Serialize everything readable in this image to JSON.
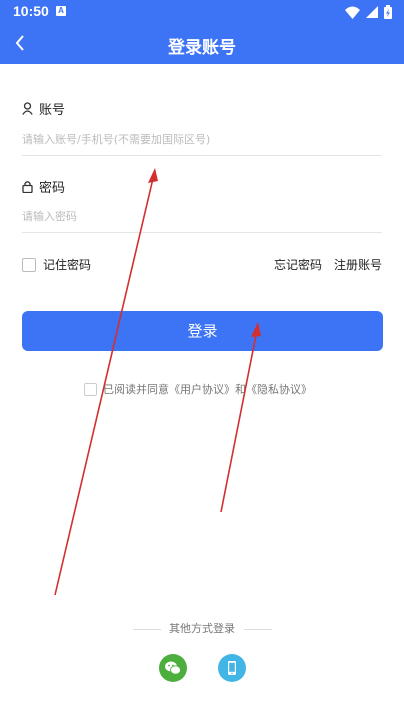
{
  "status_bar": {
    "time": "10:50",
    "notification_icon": "a-icon"
  },
  "header": {
    "title": "登录账号",
    "back_icon": "back-arrow-icon"
  },
  "account": {
    "label": "账号",
    "placeholder": "请输入账号/手机号(不需要加国际区号)"
  },
  "password": {
    "label": "密码",
    "placeholder": "请输入密码"
  },
  "options": {
    "remember_label": "记住密码",
    "forgot_label": "忘记密码",
    "register_label": "注册账号"
  },
  "login_button": {
    "label": "登录"
  },
  "agreement": {
    "text": "已阅读并同意《用户协议》和《隐私协议》"
  },
  "other_login": {
    "label": "其他方式登录",
    "icons": [
      "wechat-icon",
      "phone-icon"
    ]
  },
  "colors": {
    "primary": "#3d73f5",
    "wechat": "#4caf3d",
    "phone": "#41b6e6",
    "annotation": "#d32f2f"
  }
}
